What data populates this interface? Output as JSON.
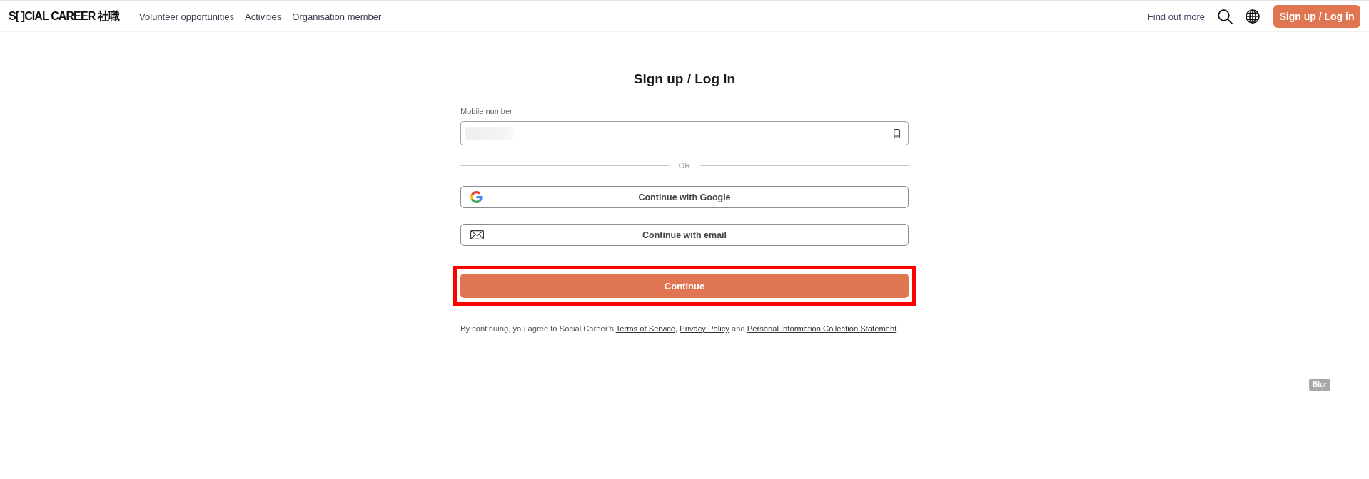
{
  "header": {
    "logo": "S[ ]CIAL CAREER 社職",
    "nav": [
      "Volunteer opportunities",
      "Activities",
      "Organisation member"
    ],
    "find_out_more": "Find out more",
    "auth_button": "Sign up / Log in"
  },
  "form": {
    "title": "Sign up / Log in",
    "mobile": {
      "label": "Mobile number",
      "value_blurred": true
    },
    "divider": "OR",
    "providers": [
      {
        "kind": "google",
        "label": "Continue with Google"
      },
      {
        "kind": "email",
        "label": "Continue with email"
      }
    ],
    "continue_button": {
      "label": "Continue",
      "highlighted": true
    },
    "terms": [
      {
        "kind": "text",
        "text": "By continuing, you agree to Social Career’s "
      },
      {
        "kind": "link",
        "text": "Terms of Service"
      },
      {
        "kind": "text",
        "text": ", "
      },
      {
        "kind": "link",
        "text": "Privacy Policy"
      },
      {
        "kind": "text",
        "text": " and "
      },
      {
        "kind": "link",
        "text": "Personal Information Collection Statement"
      },
      {
        "kind": "text",
        "text": "."
      }
    ]
  },
  "corner_badge": "Blur"
}
